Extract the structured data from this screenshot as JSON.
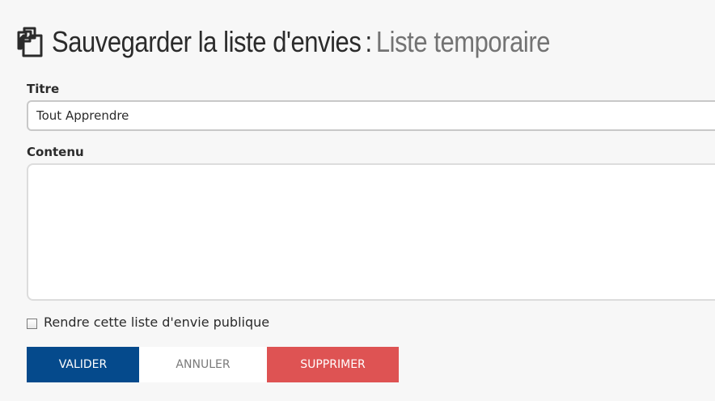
{
  "header": {
    "icon": "copy-icon",
    "title": "Sauvegarder la liste d'envies",
    "separator": ":",
    "subtitle": "Liste temporaire"
  },
  "form": {
    "title_label": "Titre",
    "title_value": "Tout Apprendre",
    "content_label": "Contenu",
    "content_value": "",
    "public_checkbox_label": "Rendre cette liste d'envie publique",
    "public_checked": false
  },
  "actions": {
    "validate_label": "VALIDER",
    "cancel_label": "ANNULER",
    "delete_label": "SUPPRIMER"
  },
  "colors": {
    "validate": "#054a8c",
    "delete": "#de5353",
    "cancel_bg": "#ffffff",
    "page_bg": "#f7f7f7"
  }
}
